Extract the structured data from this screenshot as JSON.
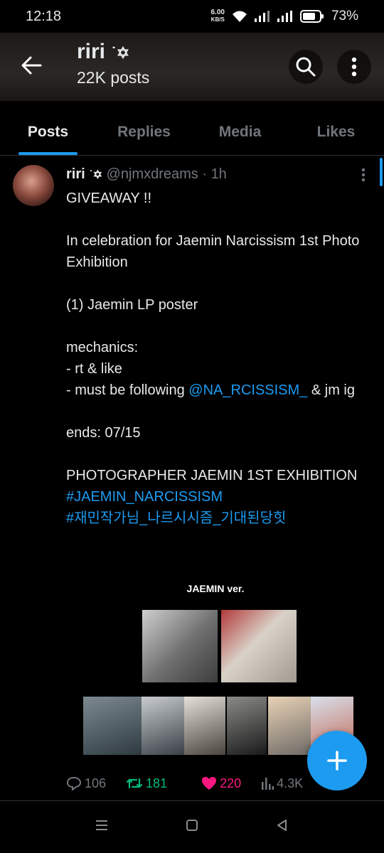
{
  "status_bar": {
    "time": "12:18",
    "net_speed_value": "6.00",
    "net_speed_unit": "KB/S",
    "battery": "73%"
  },
  "header": {
    "title": "riri",
    "title_symbol": "˙✡",
    "subtitle": "22K posts"
  },
  "tabs": [
    {
      "label": "Posts",
      "active": true
    },
    {
      "label": "Replies"
    },
    {
      "label": "Media"
    },
    {
      "label": "Likes"
    }
  ],
  "post": {
    "author_name": "riri",
    "author_symbol": "˙✡",
    "handle": "@njmxdreams",
    "separator": "·",
    "time": "1h",
    "lines": {
      "l1": "GIVEAWAY !!",
      "l2": "In celebration for Jaemin Narcissism 1st Photo Exhibition",
      "l3": "(1) Jaemin LP poster",
      "l4": "mechanics:",
      "l5": "- rt & like",
      "l6_pre": "- must be following ",
      "l6_link": "@NA_RCISSISM_",
      "l6_post": " & jm ig",
      "l7": "ends: 07/15",
      "l8": "PHOTOGRAPHER JAEMIN 1ST EXHIBITION",
      "l9": "#JAEMIN_NARCISSISM",
      "l10": "#재민작가님_나르시시즘_기대된당힛"
    },
    "media_caption": "JAEMIN ver.",
    "stats": {
      "replies": "106",
      "reposts": "181",
      "likes": "220",
      "views": "4.3K"
    }
  },
  "colors": {
    "accent": "#1d9bf0",
    "repost": "#00ba7c",
    "like": "#f91880",
    "muted": "#71767b"
  }
}
